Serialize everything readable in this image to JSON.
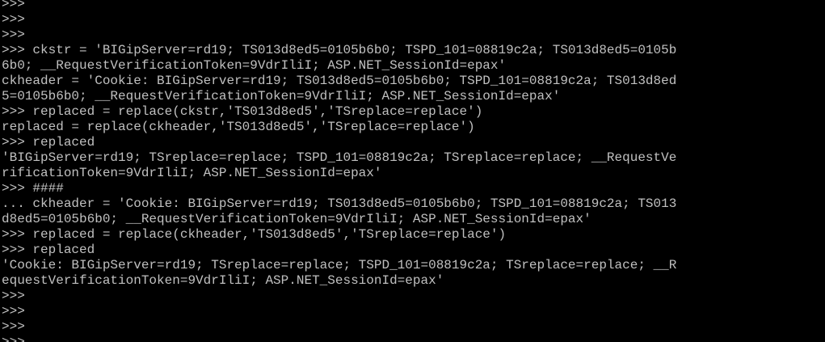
{
  "terminal": {
    "lines": [
      ">>>",
      ">>>",
      ">>>",
      ">>> ckstr = 'BIGipServer=rd19; TS013d8ed5=0105b6b0; TSPD_101=08819c2a; TS013d8ed5=0105b",
      "6b0; __RequestVerificationToken=9VdrIliI; ASP.NET_SessionId=epax'",
      "ckheader = 'Cookie: BIGipServer=rd19; TS013d8ed5=0105b6b0; TSPD_101=08819c2a; TS013d8ed",
      "5=0105b6b0; __RequestVerificationToken=9VdrIliI; ASP.NET_SessionId=epax'",
      ">>> replaced = replace(ckstr,'TS013d8ed5','TSreplace=replace')",
      "replaced = replace(ckheader,'TS013d8ed5','TSreplace=replace')",
      ">>> replaced",
      "'BIGipServer=rd19; TSreplace=replace; TSPD_101=08819c2a; TSreplace=replace; __RequestVe",
      "rificationToken=9VdrIliI; ASP.NET_SessionId=epax'",
      ">>> ####",
      "... ckheader = 'Cookie: BIGipServer=rd19; TS013d8ed5=0105b6b0; TSPD_101=08819c2a; TS013",
      "d8ed5=0105b6b0; __RequestVerificationToken=9VdrIliI; ASP.NET_SessionId=epax'",
      ">>> replaced = replace(ckheader,'TS013d8ed5','TSreplace=replace')",
      ">>> replaced",
      "'Cookie: BIGipServer=rd19; TSreplace=replace; TSPD_101=08819c2a; TSreplace=replace; __R",
      "equestVerificationToken=9VdrIliI; ASP.NET_SessionId=epax'",
      ">>>",
      ">>>",
      ">>>"
    ],
    "prompt": ">>> ",
    "colors": {
      "background": "#000000",
      "text": "#c0c0c0",
      "cursor": "#00ff00"
    }
  }
}
